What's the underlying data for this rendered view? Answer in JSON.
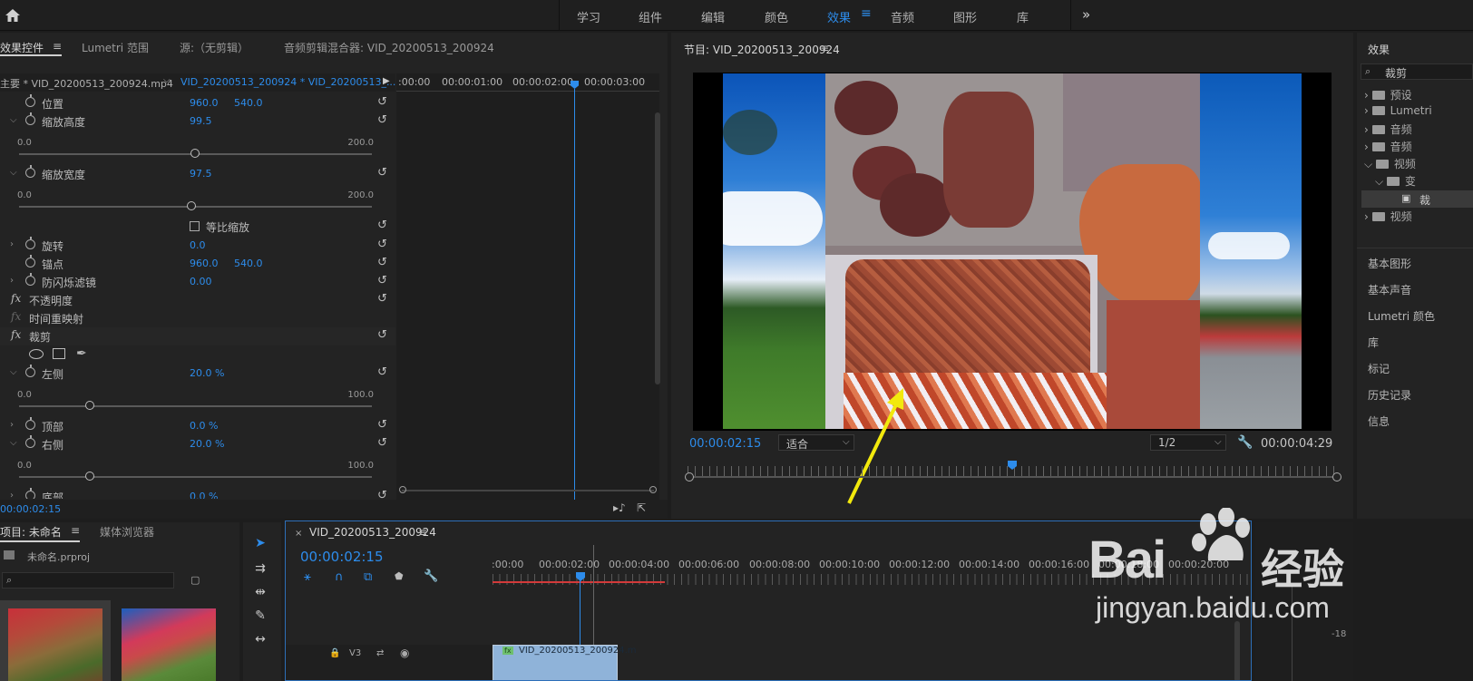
{
  "workspace_tabs": [
    "学习",
    "组件",
    "编辑",
    "颜色",
    "效果",
    "音频",
    "图形",
    "库"
  ],
  "active_workspace": "效果",
  "effect_controls": {
    "tabs": [
      "效果控件",
      "Lumetri 范围",
      "源:（无剪辑）",
      "音频剪辑混合器: VID_20200513_200924"
    ],
    "master_clip": "主要 * VID_20200513_200924.mp4",
    "sequence_clip": "VID_20200513_200924 * VID_20200513_...",
    "ruler_times": [
      ":00:00",
      "00:00:01:00",
      "00:00:02:00",
      "00:00:03:00"
    ],
    "rows": {
      "position": {
        "label": "位置",
        "v1": "960.0",
        "v2": "540.0"
      },
      "scale_height": {
        "label": "缩放高度",
        "v1": "99.5",
        "min": "0.0",
        "max": "200.0",
        "fraction": 0.4975
      },
      "scale_width": {
        "label": "缩放宽度",
        "v1": "97.5",
        "min": "0.0",
        "max": "200.0",
        "fraction": 0.4875
      },
      "uniform_scale": {
        "label": "等比缩放"
      },
      "rotation": {
        "label": "旋转",
        "v1": "0.0"
      },
      "anchor": {
        "label": "锚点",
        "v1": "960.0",
        "v2": "540.0"
      },
      "anti_flicker": {
        "label": "防闪烁滤镜",
        "v1": "0.00"
      },
      "opacity": {
        "label": "不透明度"
      },
      "time_remap": {
        "label": "时间重映射"
      },
      "crop": {
        "label": "裁剪"
      },
      "left": {
        "label": "左侧",
        "v1": "20.0 %",
        "min": "0.0",
        "max": "100.0",
        "fraction": 0.2
      },
      "top": {
        "label": "顶部",
        "v1": "0.0 %"
      },
      "right": {
        "label": "右侧",
        "v1": "20.0 %",
        "min": "0.0",
        "max": "100.0",
        "fraction": 0.2
      },
      "bottom": {
        "label": "底部",
        "v1": "0.0 %"
      }
    },
    "current_time": "00:00:02:15"
  },
  "program_monitor": {
    "title": "节目: VID_20200513_200924",
    "timecode": "00:00:02:15",
    "fit": "适合",
    "resolution": "1/2",
    "duration": "00:00:04:29",
    "playhead_fraction": 0.5
  },
  "effects_panel": {
    "title": "效果",
    "search_value": "裁剪",
    "tree": [
      "预设",
      "Lumetri",
      "音频",
      "音频",
      "视频",
      "变",
      "裁",
      "视频"
    ],
    "side_panels": [
      "基本图形",
      "基本声音",
      "Lumetri 颜色",
      "库",
      "标记",
      "历史记录",
      "信息"
    ]
  },
  "project_panel": {
    "tabs": [
      "项目: 未命名",
      "媒体浏览器"
    ],
    "file": "未命名.prproj",
    "search_placeholder": ""
  },
  "timeline": {
    "title": "VID_20200513_200924",
    "timecode": "00:00:02:15",
    "ruler": [
      ":00:00",
      "00:00:02:00",
      "00:00:04:00",
      "00:00:06:00",
      "00:00:08:00",
      "00:00:10:00",
      "00:00:12:00",
      "00:00:14:00",
      "00:00:16:00",
      "00:00:18:00",
      "00:00:20:00"
    ],
    "track": "V3",
    "clip_name": "VID_20200513_200924.m",
    "meter_label": "-18"
  },
  "watermark": {
    "brand": "Bai",
    "brand2": "经验",
    "url": "jingyan.baidu.com"
  },
  "colors": {
    "accent": "#2d8ceb",
    "bg": "#1d1d1d",
    "panel": "#232323",
    "arrow": "#f2e90d"
  }
}
